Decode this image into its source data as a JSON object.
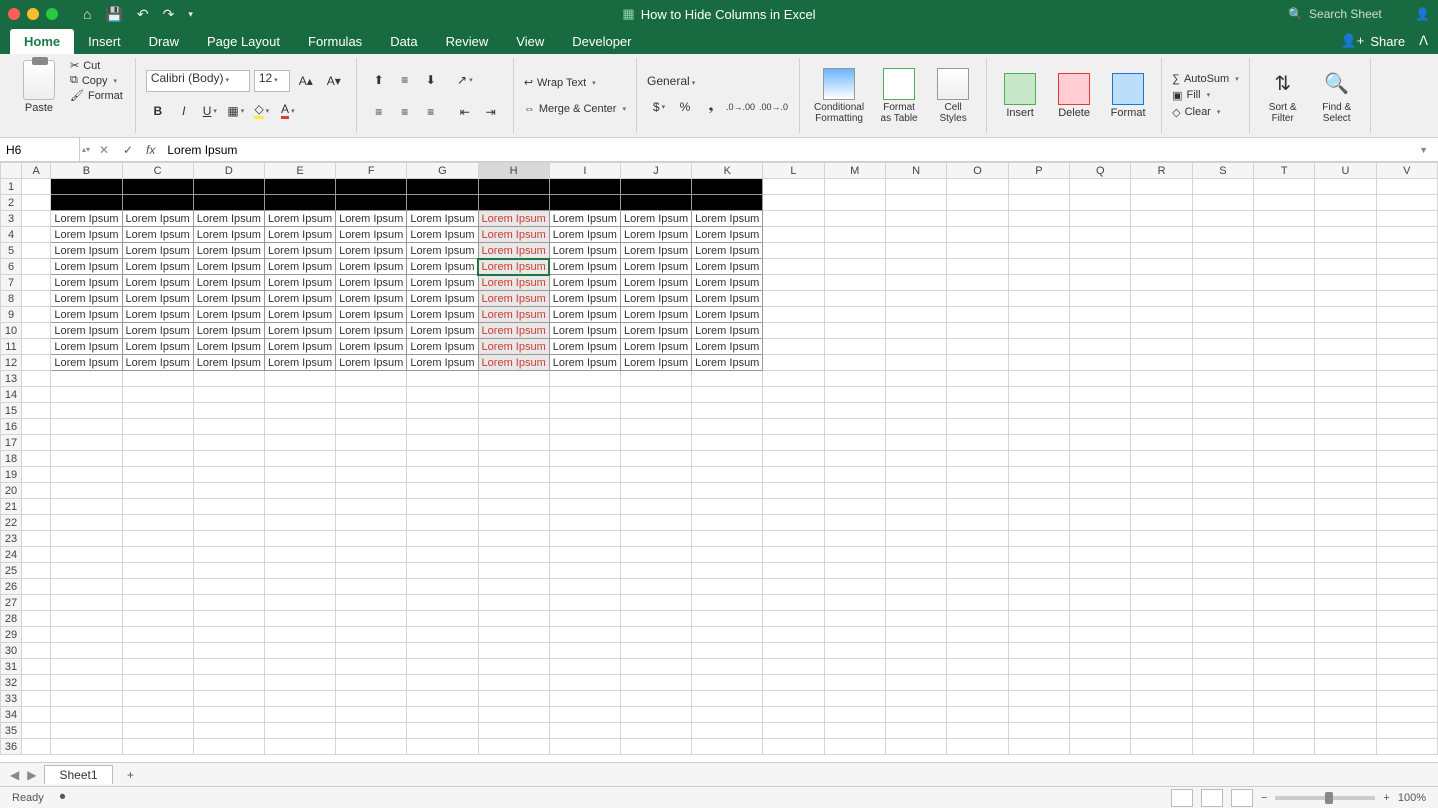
{
  "title": "How to Hide Columns in Excel",
  "search_placeholder": "Search Sheet",
  "tabs": [
    "Home",
    "Insert",
    "Draw",
    "Page Layout",
    "Formulas",
    "Data",
    "Review",
    "View",
    "Developer"
  ],
  "active_tab": "Home",
  "share": "Share",
  "clipboard": {
    "paste": "Paste",
    "cut": "Cut",
    "copy": "Copy",
    "format": "Format"
  },
  "font": {
    "name": "Calibri (Body)",
    "size": "12"
  },
  "align": {
    "wrap": "Wrap Text",
    "merge": "Merge & Center"
  },
  "number": {
    "format": "General"
  },
  "styles": {
    "cf": "Conditional\nFormatting",
    "fat": "Format\nas Table",
    "cs": "Cell\nStyles"
  },
  "cells": {
    "insert": "Insert",
    "delete": "Delete",
    "format": "Format"
  },
  "editing": {
    "autosum": "AutoSum",
    "fill": "Fill",
    "clear": "Clear",
    "sort": "Sort &\nFilter",
    "find": "Find &\nSelect"
  },
  "namebox": "H6",
  "formula": "Lorem Ipsum",
  "columns": [
    "A",
    "B",
    "C",
    "D",
    "E",
    "F",
    "G",
    "H",
    "I",
    "J",
    "K",
    "L",
    "M",
    "N",
    "O",
    "P",
    "Q",
    "R",
    "S",
    "T",
    "U",
    "V"
  ],
  "selected_col": "H",
  "active_row": 6,
  "data_rows": [
    3,
    4,
    5,
    6,
    7,
    8,
    9,
    10,
    11,
    12
  ],
  "data_cols": [
    "B",
    "C",
    "D",
    "E",
    "F",
    "G",
    "H",
    "I",
    "J",
    "K"
  ],
  "cell_text": "Lorem Ipsum",
  "total_rows": 36,
  "sheet_tab": "Sheet1",
  "status": "Ready",
  "zoom": "100%"
}
